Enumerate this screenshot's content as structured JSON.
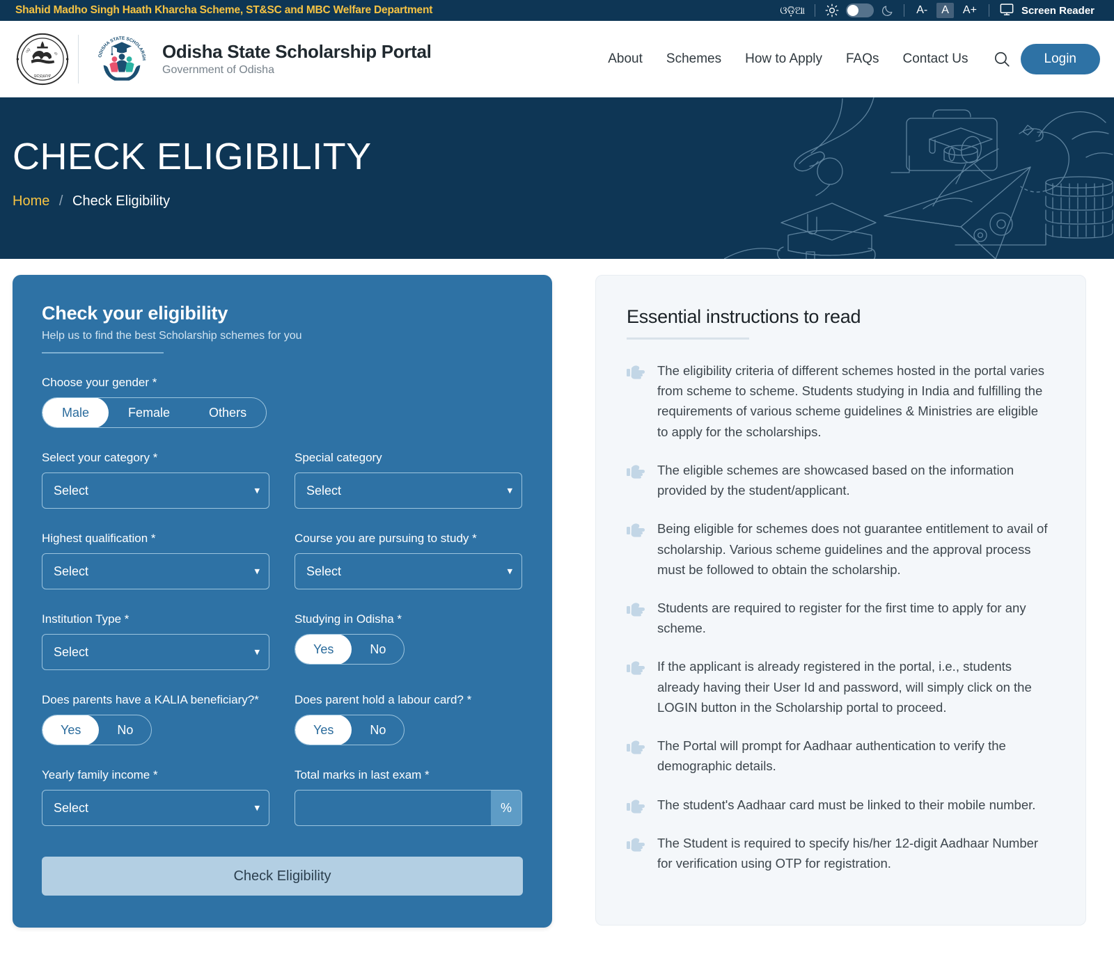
{
  "topbar": {
    "marquee": "Shahid Madho Singh Haath Kharcha Scheme, ST&SC and MBC Welfare Department",
    "language_label": "ଓଡ଼ିଆ",
    "sun_icon": "sun-icon",
    "theme_toggle": "theme-toggle",
    "moon_icon": "moon-icon",
    "font_decrease": "A-",
    "font_normal": "A",
    "font_increase": "A+",
    "screen_reader": "Screen Reader",
    "screen_reader_icon": "monitor-icon"
  },
  "header": {
    "emblem_icon": "odisha-state-emblem",
    "portal_logo_icon": "scholarship-portal-logo",
    "title": "Odisha State Scholarship Portal",
    "subtitle": "Government of Odisha",
    "nav": [
      {
        "label": "About"
      },
      {
        "label": "Schemes"
      },
      {
        "label": "How to Apply"
      },
      {
        "label": "FAQs"
      },
      {
        "label": "Contact Us"
      }
    ],
    "search_icon": "search-icon",
    "login_label": "Login"
  },
  "hero": {
    "title": "CHECK ELIGIBILITY",
    "breadcrumb_home": "Home",
    "breadcrumb_sep": "/",
    "breadcrumb_current": "Check Eligibility",
    "illustration_icon": "education-line-art-illustration"
  },
  "form": {
    "title": "Check your eligibility",
    "subtitle": "Help us to find the best Scholarship schemes for you",
    "gender": {
      "label": "Choose your gender *",
      "options": [
        "Male",
        "Female",
        "Others"
      ],
      "selected": "Male"
    },
    "category": {
      "label": "Select your category *",
      "value": "Select"
    },
    "special_category": {
      "label": "Special category",
      "value": "Select"
    },
    "highest_qualification": {
      "label": "Highest qualification *",
      "value": "Select"
    },
    "course": {
      "label": "Course you are pursuing to study *",
      "value": "Select"
    },
    "institution_type": {
      "label": "Institution Type *",
      "value": "Select"
    },
    "studying_in_odisha": {
      "label": "Studying in Odisha *",
      "options": [
        "Yes",
        "No"
      ],
      "selected": "Yes"
    },
    "kalia": {
      "label": "Does parents have a KALIA beneficiary?*",
      "options": [
        "Yes",
        "No"
      ],
      "selected": "Yes"
    },
    "labour_card": {
      "label": "Does parent hold a labour card? *",
      "options": [
        "Yes",
        "No"
      ],
      "selected": "Yes"
    },
    "yearly_income": {
      "label": "Yearly family income *",
      "value": "Select"
    },
    "total_marks": {
      "label": "Total marks in last exam *",
      "value": "",
      "placeholder": "",
      "suffix": "%"
    },
    "submit_label": "Check Eligibility"
  },
  "instructions": {
    "title": "Essential instructions to read",
    "bullet_icon": "pointing-hand-icon",
    "items": [
      "The eligibility criteria of different schemes hosted in the portal varies from scheme to scheme. Students studying in India and fulfilling the requirements of various scheme guidelines & Ministries are eligible to apply for the scholarships.",
      "The eligible schemes are showcased based on the information provided by the student/applicant.",
      "Being eligible for schemes does not guarantee entitlement to avail of scholarship. Various scheme guidelines and the approval process must be followed to obtain the scholarship.",
      "Students are required to register for the first time to apply for any scheme.",
      "If the applicant is already registered in the portal, i.e., students already having their User Id and password, will simply click on the LOGIN button in the Scholarship portal to proceed.",
      "The Portal will prompt for Aadhaar authentication to verify the demographic details.",
      "The student's Aadhaar card must be linked to their mobile number.",
      "The Student is required to specify his/her 12-digit Aadhaar Number for verification using OTP for registration."
    ]
  },
  "colors": {
    "navy": "#0E3655",
    "brand_blue": "#2E72A5",
    "accent_yellow": "#F6C343",
    "panel_bg": "#F4F7FA",
    "submit_bg": "#B3CFE3"
  }
}
